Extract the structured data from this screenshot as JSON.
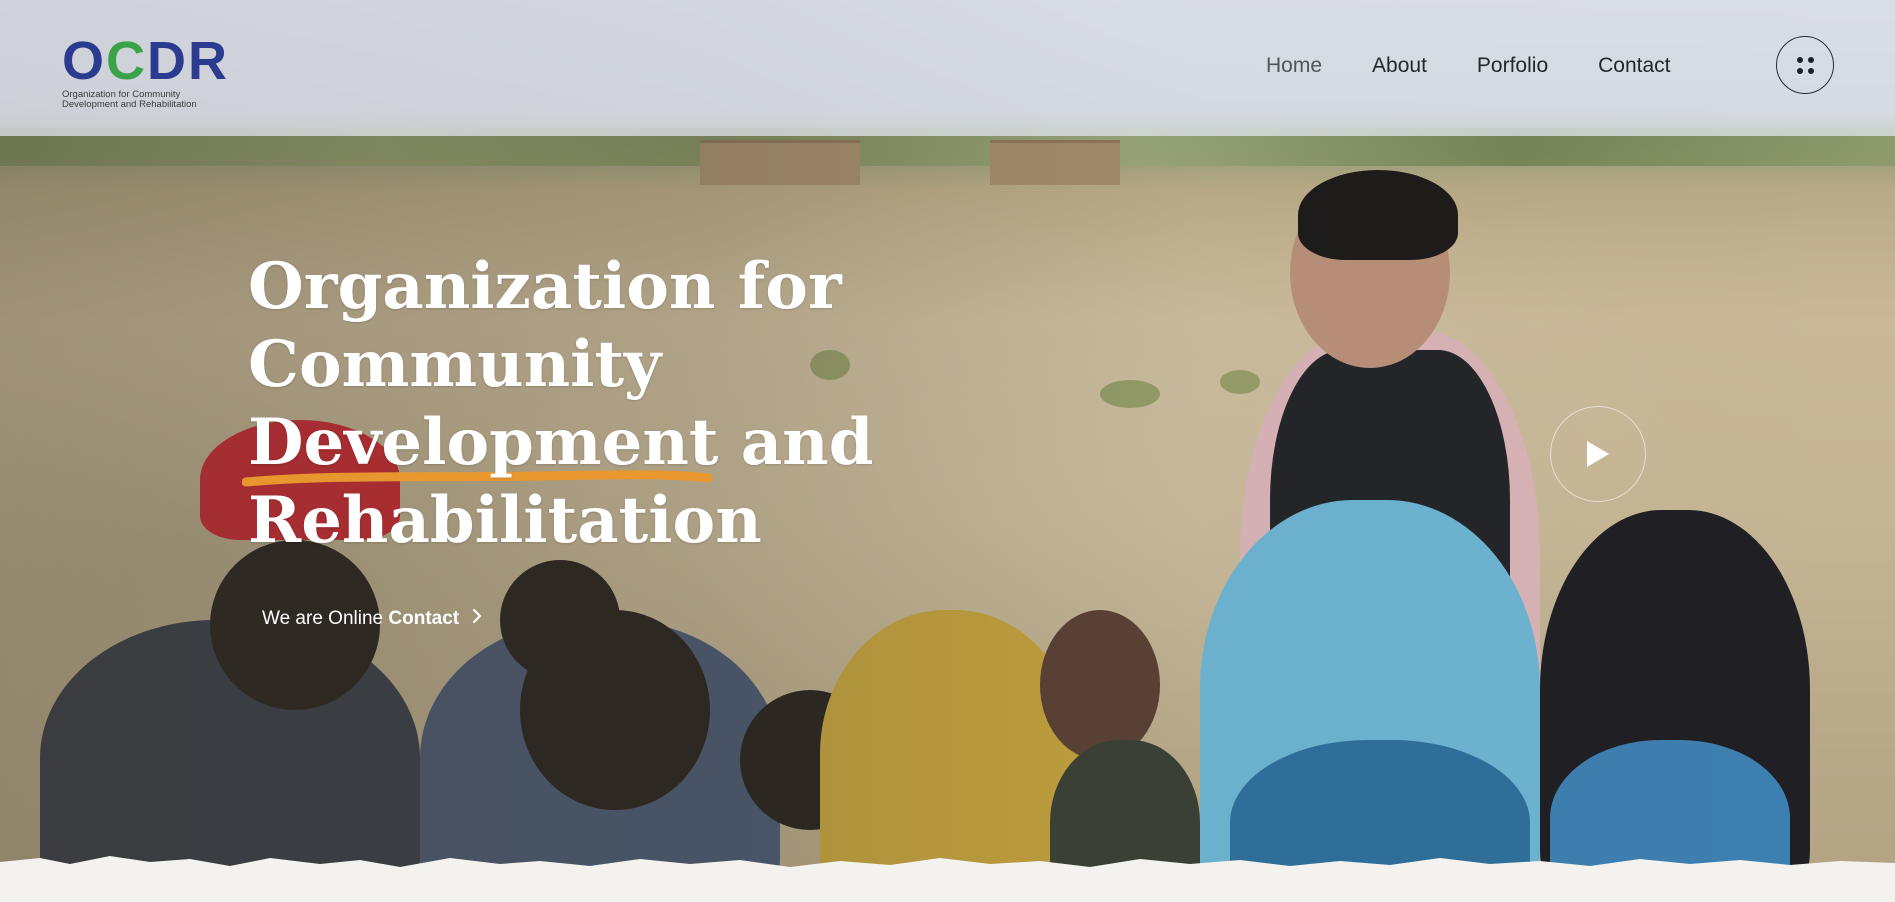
{
  "logo": {
    "mark": "OCDR",
    "mark_prefix": "O",
    "mark_c": "C",
    "mark_suffix": "DR",
    "subtitle_line1": "Organization for Community",
    "subtitle_line2": "Development and Rehabilitation"
  },
  "nav": {
    "items": [
      {
        "label": "Home",
        "active": true
      },
      {
        "label": "About"
      },
      {
        "label": "Porfolio"
      },
      {
        "label": "Contact"
      }
    ]
  },
  "menu_button": {
    "icon": "grid-dots-icon"
  },
  "hero": {
    "line1": "Organization for",
    "line2": "Community",
    "line3_highlight": "Development",
    "line3_rest": " and",
    "line4": "Rehabilitation",
    "cta_prefix": "We are Online",
    "cta_link": "Contact",
    "cta_icon": "chevron-right-icon",
    "play_icon": "play-icon"
  },
  "colors": {
    "brand_blue": "#2b3b8f",
    "brand_green": "#3aa34a",
    "highlight_orange": "#e8972f",
    "nav_text": "#1f2a2a"
  }
}
